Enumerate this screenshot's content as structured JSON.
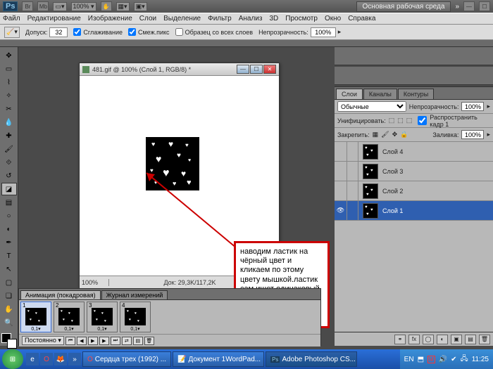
{
  "titlebar": {
    "ps": "Ps",
    "zoom": "100% ▾",
    "workspace": "Основная рабочая среда",
    "chev": "»"
  },
  "menu": {
    "items": [
      "Файл",
      "Редактирование",
      "Изображение",
      "Слои",
      "Выделение",
      "Фильтр",
      "Анализ",
      "3D",
      "Просмотр",
      "Окно",
      "Справка"
    ]
  },
  "options": {
    "tolerance_label": "Допуск:",
    "tolerance": "32",
    "antialias": "Сглаживание",
    "contiguous": "Смеж.пикс",
    "all_layers": "Образец со всех слоев",
    "opacity_label": "Непрозрачность:",
    "opacity": "100%"
  },
  "doc": {
    "title": "481.gif @ 100% (Слой 1, RGB/8) *",
    "zoom": "100%",
    "info": "Док: 29,3K/117,2K"
  },
  "annotation": "наводим ластик на чёрный цвет и кликаем по этому цвету мышкой.ластик сам ищет одинаковый цвет а именно тот по которому кликаете мышкой",
  "layers_panel": {
    "tabs": [
      "Слои",
      "Каналы",
      "Контуры"
    ],
    "mode": "Обычные",
    "opacity_label": "Непрозрачность:",
    "opacity": "100%",
    "unify": "Унифицировать:",
    "propagate": "Распространить кадр 1",
    "lock": "Закрепить:",
    "fill_label": "Заливка:",
    "fill": "100%",
    "layers": [
      {
        "name": "Слой 4",
        "visible": false,
        "selected": false
      },
      {
        "name": "Слой 3",
        "visible": false,
        "selected": false
      },
      {
        "name": "Слой 2",
        "visible": false,
        "selected": false
      },
      {
        "name": "Слой 1",
        "visible": true,
        "selected": true
      }
    ]
  },
  "anim": {
    "tabs": [
      "Анимация (покадровая)",
      "Журнал измерений"
    ],
    "frames": [
      {
        "n": "1",
        "t": "0,1▾",
        "sel": true
      },
      {
        "n": "2",
        "t": "0,1▾",
        "sel": false
      },
      {
        "n": "3",
        "t": "0,1▾",
        "sel": false
      },
      {
        "n": "4",
        "t": "0,1▾",
        "sel": false
      }
    ],
    "loop": "Постоянно ▾"
  },
  "taskbar": {
    "tasks": [
      {
        "label": "Сердца трех (1992) ...",
        "icon": "O"
      },
      {
        "label": "Документ 1WordPad...",
        "icon": "📝"
      },
      {
        "label": "Adobe Photoshop CS...",
        "icon": "Ps",
        "active": true
      }
    ],
    "lang": "EN",
    "time": "11:25"
  }
}
